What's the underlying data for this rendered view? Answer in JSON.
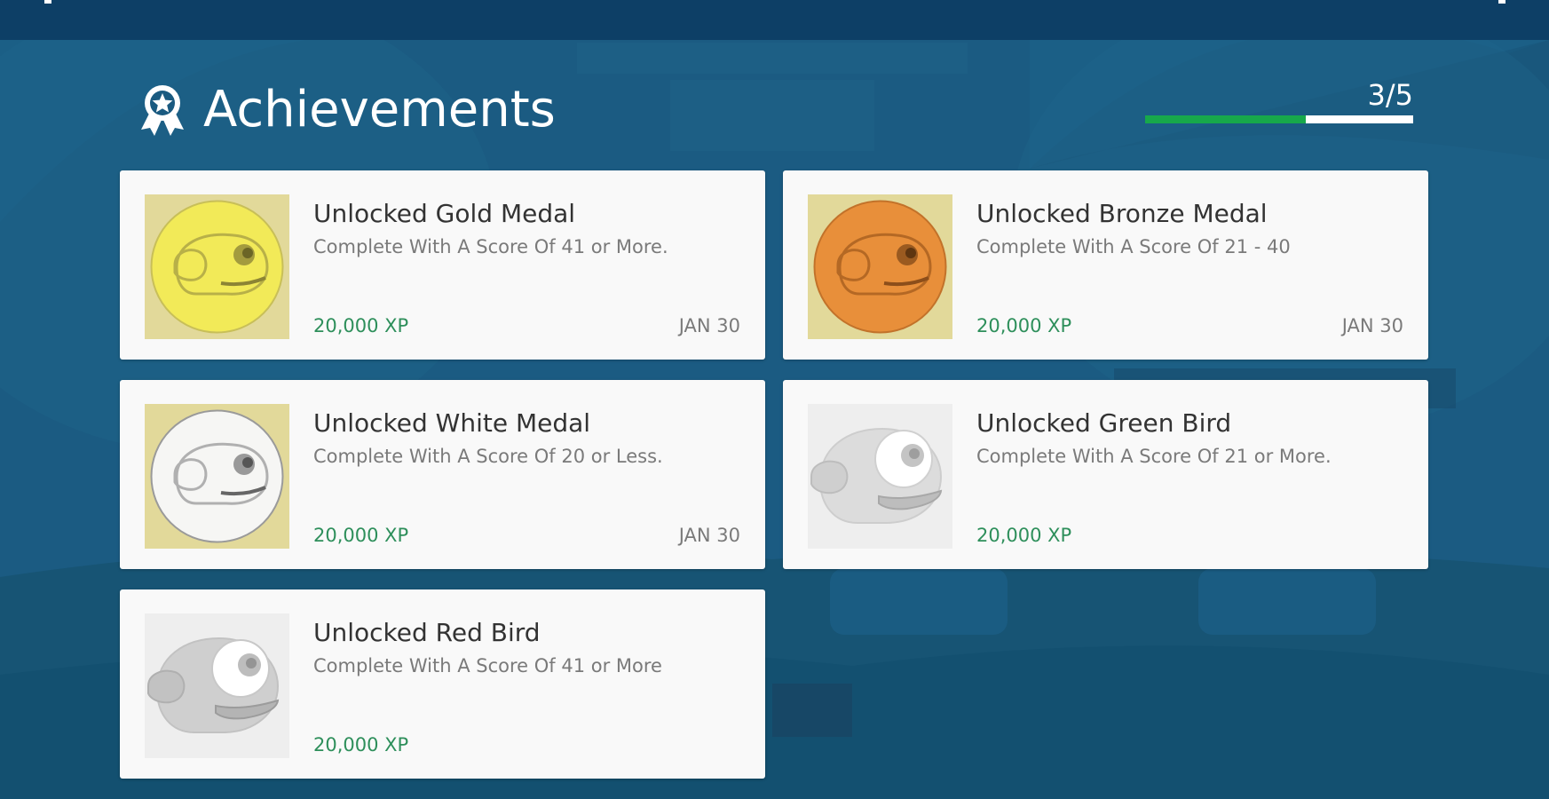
{
  "header": {
    "title": "Achievements",
    "progress_text": "3/5",
    "progress": {
      "unlocked": 3,
      "total": 5
    },
    "icon": "award-ribbon-icon"
  },
  "colors": {
    "background": "#1a5a80",
    "top_bar": "#0d3f66",
    "card": "#f9f9f9",
    "xp_green": "#2e8f5b",
    "progress_green": "#17a84b",
    "progress_track": "#ffffff"
  },
  "achievements": [
    {
      "title": "Unlocked Gold Medal",
      "description": "Complete With A Score Of 41 or More.",
      "xp": "20,000 XP",
      "date": "JAN 30",
      "icon": "gold-medal-icon",
      "unlocked": true
    },
    {
      "title": "Unlocked Bronze Medal",
      "description": "Complete With A Score Of 21 - 40",
      "xp": "20,000 XP",
      "date": "JAN 30",
      "icon": "bronze-medal-icon",
      "unlocked": true
    },
    {
      "title": "Unlocked White Medal",
      "description": "Complete With A Score Of 20 or Less.",
      "xp": "20,000 XP",
      "date": "JAN 30",
      "icon": "white-medal-icon",
      "unlocked": true
    },
    {
      "title": "Unlocked Green Bird",
      "description": "Complete With A Score Of 21 or More.",
      "xp": "20,000 XP",
      "date": "",
      "icon": "green-bird-icon",
      "unlocked": false
    },
    {
      "title": "Unlocked Red Bird",
      "description": "Complete With A Score Of 41 or More",
      "xp": "20,000 XP",
      "date": "",
      "icon": "red-bird-icon",
      "unlocked": false
    }
  ]
}
